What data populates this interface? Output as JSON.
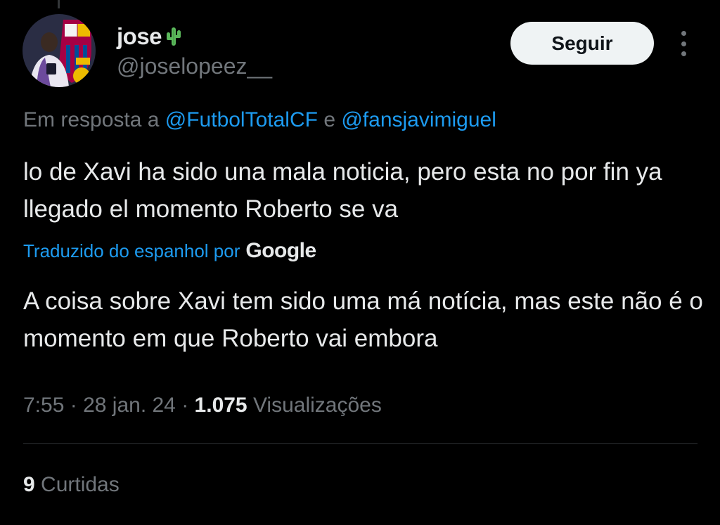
{
  "user": {
    "display_name": "jose",
    "name_emoji_icon": "cactus-icon",
    "handle": "@joselopeez__",
    "avatar_icon": "avatar-fc-barcelona-photo"
  },
  "follow_button": {
    "label": "Seguir"
  },
  "more_menu_icon": "more-vertical-icon",
  "reply": {
    "prefix": "Em resposta a",
    "mention_1": "@FutbolTotalCF",
    "conjunction": "e",
    "mention_2": "@fansjavimiguel"
  },
  "tweet": {
    "text": "lo de Xavi ha sido una mala noticia, pero esta no por fin ya llegado el momento Roberto se va"
  },
  "translation": {
    "label": "Traduzido do espanhol por",
    "provider": "Google",
    "text": "A coisa sobre Xavi tem sido uma má notícia, mas este não é o momento em que Roberto vai embora"
  },
  "meta": {
    "time": "7:55",
    "separator": "·",
    "date": "28 jan. 24",
    "views_count": "1.075",
    "views_label": "Visualizações"
  },
  "likes": {
    "count": "9",
    "label": "Curtidas"
  },
  "colors": {
    "background": "#000000",
    "text_primary": "#e7e9ea",
    "text_secondary": "#71767b",
    "link": "#1d9bf0",
    "button_bg": "#eff3f4",
    "divider": "#2f3336"
  }
}
